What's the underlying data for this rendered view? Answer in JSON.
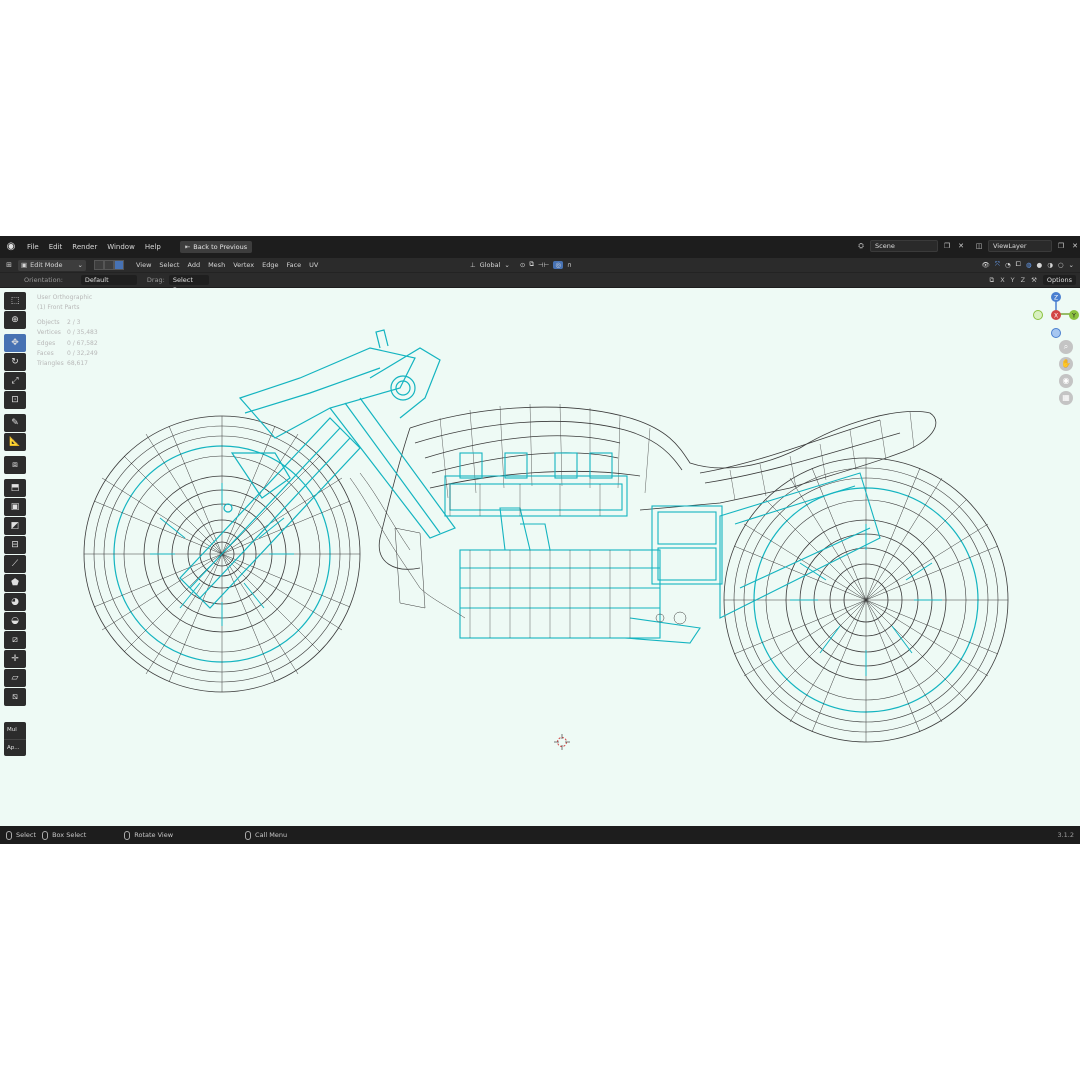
{
  "topbar": {
    "menus": [
      "File",
      "Edit",
      "Render",
      "Window",
      "Help"
    ],
    "back_button": "Back to Previous",
    "scene": "Scene",
    "view_layer": "ViewLayer"
  },
  "header": {
    "mode": "Edit Mode",
    "menus": [
      "View",
      "Select",
      "Add",
      "Mesh",
      "Vertex",
      "Edge",
      "Face",
      "UV"
    ],
    "transform_orientation": "Global"
  },
  "tool_settings": {
    "orientation_label": "Orientation:",
    "orientation_value": "Default",
    "drag_label": "Drag:",
    "drag_value": "Select Box",
    "axes": [
      "X",
      "Y",
      "Z"
    ],
    "options": "Options"
  },
  "viewport": {
    "view_name": "User Orthographic",
    "collection": "(1) Front Parts",
    "stats": [
      {
        "label": "Objects",
        "value": "2 / 3"
      },
      {
        "label": "Vertices",
        "value": "0 / 35,483"
      },
      {
        "label": "Edges",
        "value": "0 / 67,582"
      },
      {
        "label": "Faces",
        "value": "0 / 32,249"
      },
      {
        "label": "Triangles",
        "value": "68,617"
      }
    ],
    "gizmo": {
      "z": "Z",
      "x": "X",
      "y": "Y"
    },
    "colors": {
      "background": "#eefaf5",
      "selected_wire": "#14b4c0",
      "wire": "#3a3a3a"
    }
  },
  "last_operator": {
    "title": "Mul",
    "apply": "Ap..."
  },
  "statusbar": {
    "items": [
      "Select",
      "Box Select",
      "Rotate View",
      "Call Menu"
    ],
    "version": "3.1.2"
  }
}
